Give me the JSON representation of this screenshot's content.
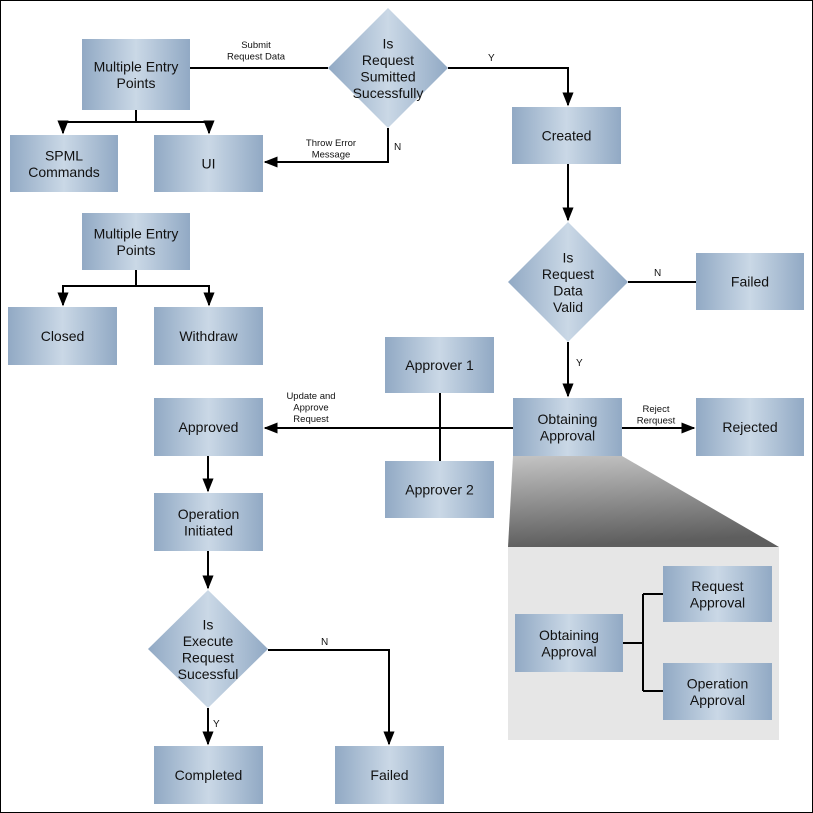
{
  "nodes": {
    "mep1": [
      "Multiple Entry",
      "Points"
    ],
    "spml": [
      "SPML",
      "Commands"
    ],
    "ui": [
      "UI"
    ],
    "d_submitted": [
      "Is",
      "Request",
      "Sumitted",
      "Sucessfully"
    ],
    "created": [
      "Created"
    ],
    "d_valid": [
      "Is",
      "Request",
      "Data",
      "Valid"
    ],
    "failed1": [
      "Failed"
    ],
    "mep2": [
      "Multiple Entry",
      "Points"
    ],
    "closed": [
      "Closed"
    ],
    "withdraw": [
      "Withdraw"
    ],
    "approver1": [
      "Approver 1"
    ],
    "approver2": [
      "Approver 2"
    ],
    "approved": [
      "Approved"
    ],
    "obtaining": [
      "Obtaining",
      "Approval"
    ],
    "rejected": [
      "Rejected"
    ],
    "op_initiated": [
      "Operation",
      "Initiated"
    ],
    "d_execute": [
      "Is",
      "Execute",
      "Request",
      "Sucessful"
    ],
    "completed": [
      "Completed"
    ],
    "failed2": [
      "Failed"
    ],
    "obtaining_detail": [
      "Obtaining",
      "Approval"
    ],
    "request_approval": [
      "Request",
      "Approval"
    ],
    "operation_approval": [
      "Operation",
      "Approval"
    ]
  },
  "edge_labels": {
    "submit": [
      "Submit",
      "Request Data"
    ],
    "throw_error": [
      "Throw Error",
      "Message"
    ],
    "update_approve": [
      "Update and",
      "Approve",
      "Request"
    ],
    "reject": [
      "Reject",
      "Rerquest"
    ],
    "y1": "Y",
    "n1": "N",
    "n2": "N",
    "y2": "Y",
    "n3": "N",
    "y3": "Y"
  },
  "colors": {
    "box_edge": "#94acc6",
    "box_mid": "#c9d7e5",
    "panel": "#e6e6e6",
    "line": "#000000"
  }
}
